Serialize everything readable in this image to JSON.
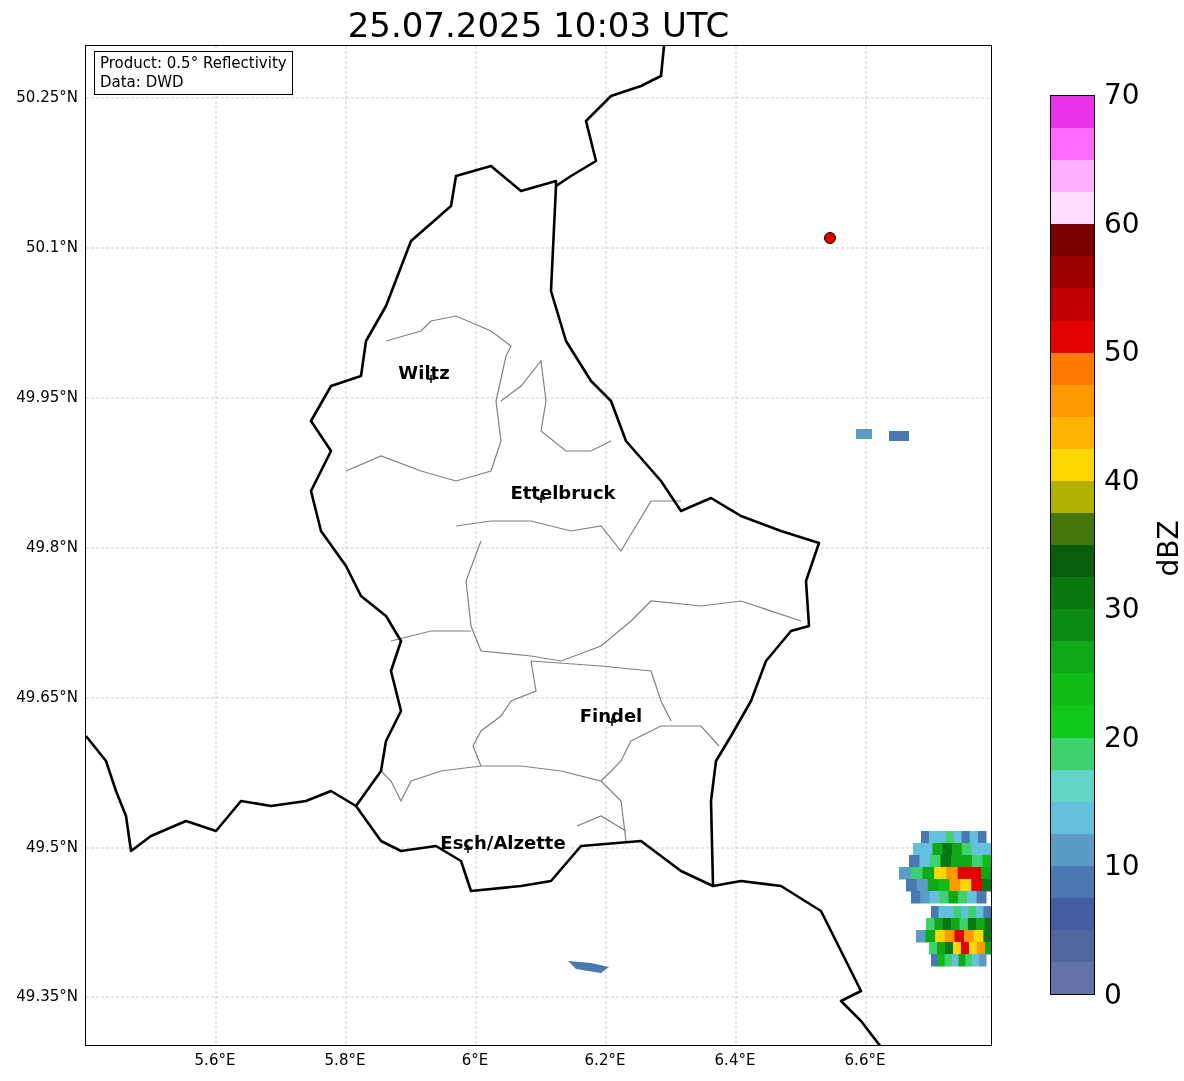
{
  "title": "25.07.2025 10:03 UTC",
  "info_box": {
    "lines": [
      "Product: 0.5° Reflectivity",
      "Data: DWD"
    ]
  },
  "axes": {
    "x_ticks": [
      "5.6°E",
      "5.8°E",
      "6°E",
      "6.2°E",
      "6.4°E",
      "6.6°E"
    ],
    "y_ticks": [
      "50.25°N",
      "50.1°N",
      "49.95°N",
      "49.8°N",
      "49.65°N",
      "49.5°N",
      "49.35°N"
    ]
  },
  "places": [
    {
      "name": "Wiltz"
    },
    {
      "name": "Ettelbruck"
    },
    {
      "name": "Findel"
    },
    {
      "name": "Esch/Alzette"
    }
  ],
  "colorbar": {
    "label": "dBZ",
    "ticks": [
      "70",
      "60",
      "50",
      "40",
      "30",
      "20",
      "10",
      "0"
    ],
    "segments": [
      {
        "color": "#6272a6"
      },
      {
        "color": "#52679e"
      },
      {
        "color": "#435da0"
      },
      {
        "color": "#4a78b0"
      },
      {
        "color": "#5a9cc6"
      },
      {
        "color": "#64c0dc"
      },
      {
        "color": "#62d5c6"
      },
      {
        "color": "#3ed170"
      },
      {
        "color": "#10c81a"
      },
      {
        "color": "#10bb18"
      },
      {
        "color": "#10a816"
      },
      {
        "color": "#0d8a14"
      },
      {
        "color": "#0a7811"
      },
      {
        "color": "#085e0c"
      },
      {
        "color": "#44760c"
      },
      {
        "color": "#b2b204"
      },
      {
        "color": "#ffd700"
      },
      {
        "color": "#ffb400"
      },
      {
        "color": "#ff9900"
      },
      {
        "color": "#ff7b00"
      },
      {
        "color": "#e30000"
      },
      {
        "color": "#c00000"
      },
      {
        "color": "#9c0000"
      },
      {
        "color": "#780000"
      },
      {
        "color": "#ffe0ff"
      },
      {
        "color": "#ffb0ff"
      },
      {
        "color": "#ff6aff"
      },
      {
        "color": "#ea32ea"
      }
    ]
  }
}
